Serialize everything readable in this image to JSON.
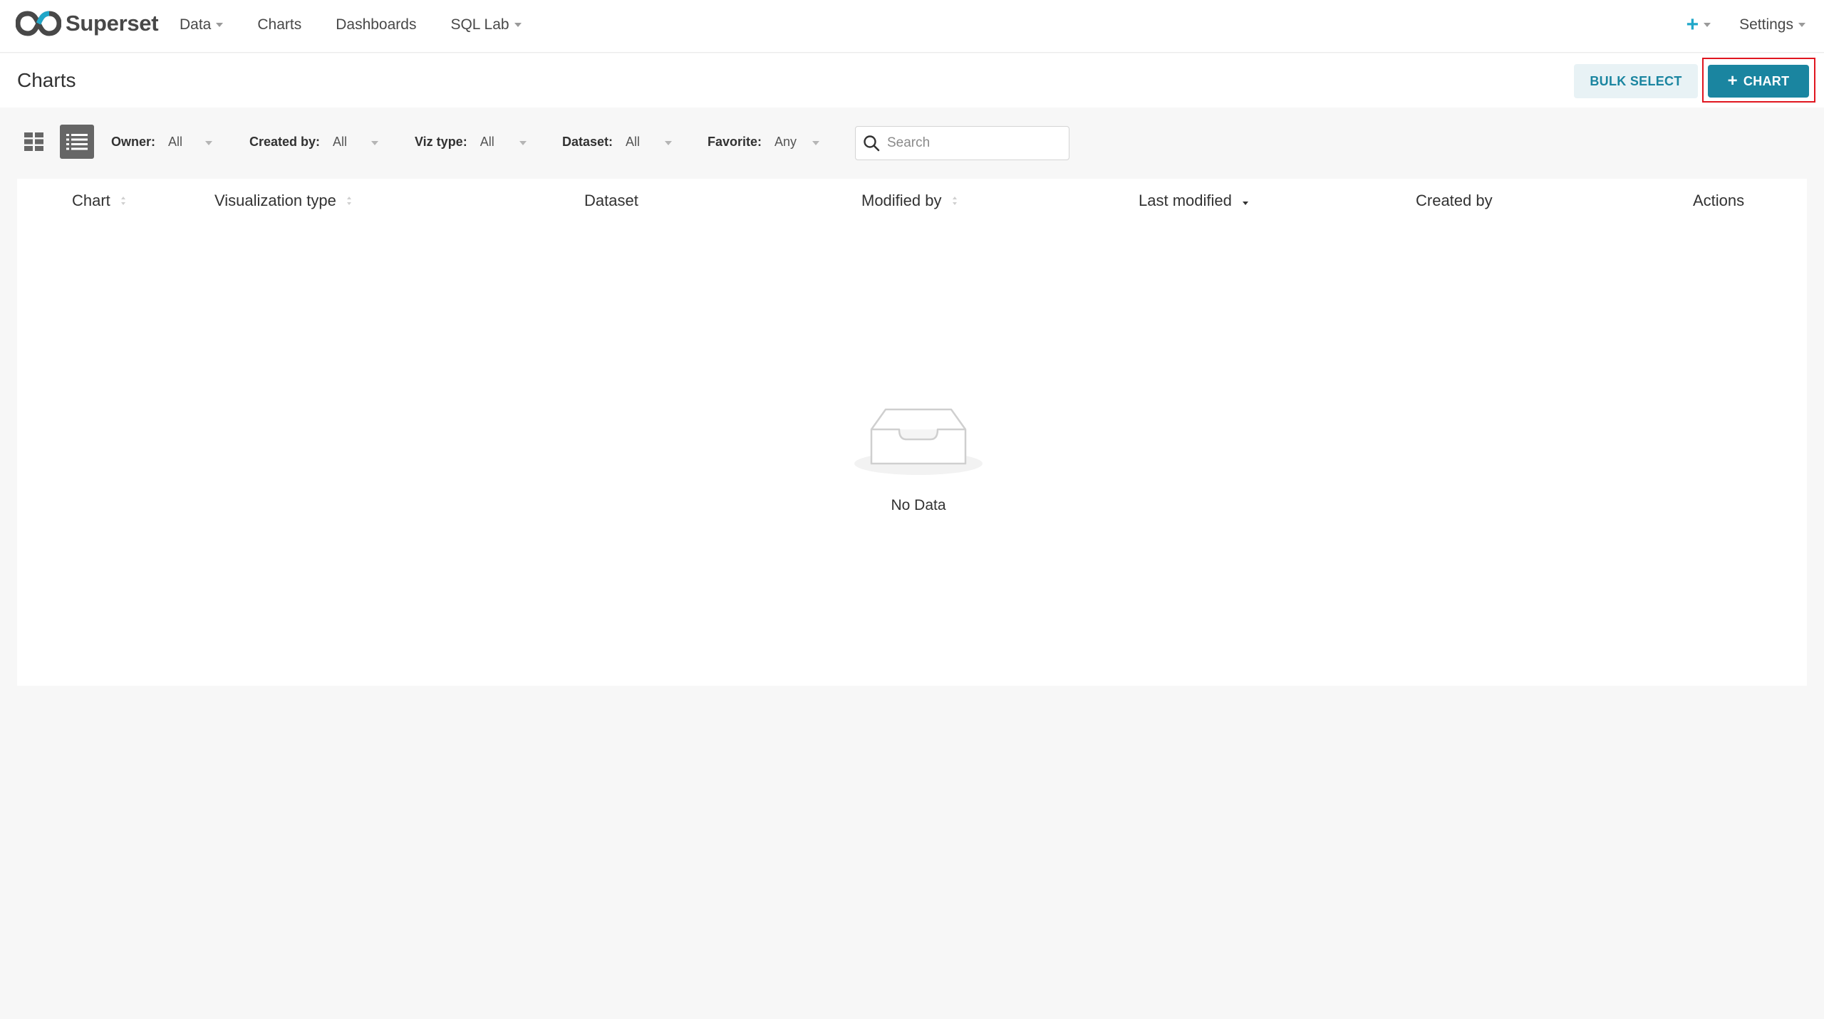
{
  "brand": {
    "name": "Superset"
  },
  "nav": {
    "items": [
      {
        "label": "Data",
        "has_dropdown": true
      },
      {
        "label": "Charts",
        "has_dropdown": false
      },
      {
        "label": "Dashboards",
        "has_dropdown": false
      },
      {
        "label": "SQL Lab",
        "has_dropdown": true
      }
    ],
    "plus_icon": "plus-icon",
    "settings_label": "Settings"
  },
  "header": {
    "title": "Charts",
    "bulk_select_label": "BULK SELECT",
    "add_chart_label": "CHART"
  },
  "filters": {
    "view_modes": [
      "card-view-icon",
      "list-view-icon"
    ],
    "active_view": "list",
    "owner": {
      "label": "Owner:",
      "value": "All"
    },
    "created_by": {
      "label": "Created by:",
      "value": "All"
    },
    "viz_type": {
      "label": "Viz type:",
      "value": "All"
    },
    "dataset": {
      "label": "Dataset:",
      "value": "All"
    },
    "favorite": {
      "label": "Favorite:",
      "value": "Any"
    },
    "search": {
      "placeholder": "Search",
      "value": ""
    }
  },
  "table": {
    "columns": [
      {
        "label": "Chart",
        "sortable": true
      },
      {
        "label": "Visualization type",
        "sortable": true
      },
      {
        "label": "Dataset",
        "sortable": false
      },
      {
        "label": "Modified by",
        "sortable": true
      },
      {
        "label": "Last modified",
        "sortable": true,
        "sorted": "desc"
      },
      {
        "label": "Created by",
        "sortable": false
      },
      {
        "label": "Actions",
        "sortable": false
      }
    ],
    "rows": [],
    "empty_text": "No Data"
  },
  "colors": {
    "primary": "#1a85a0",
    "primary_light": "#e8f2f5",
    "accent": "#20a7c9",
    "highlight_border": "#e0161f"
  }
}
